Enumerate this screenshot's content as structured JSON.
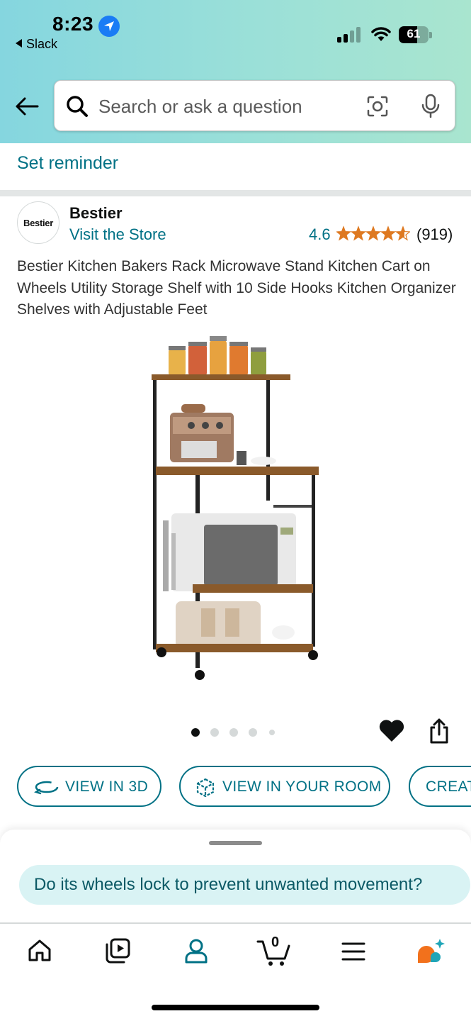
{
  "status_bar": {
    "time": "8:23",
    "back_app": "Slack",
    "battery_percent": "61",
    "battery_level": 0.61
  },
  "search": {
    "placeholder": "Search or ask a question"
  },
  "reminder": {
    "label": "Set reminder"
  },
  "brand": {
    "logo_text": "Bestier",
    "name": "Bestier",
    "store_link": "Visit the Store"
  },
  "rating": {
    "value": "4.6",
    "stars": 4.6,
    "count": "(919)"
  },
  "product": {
    "title": "Bestier Kitchen Bakers Rack Microwave Stand Kitchen Cart on Wheels Utility Storage Shelf with 10 Side Hooks Kitchen Organizer Shelves with Adjustable Feet",
    "image_count": 5,
    "active_image_index": 0
  },
  "actions": {
    "view_3d": "VIEW IN 3D",
    "view_room": "VIEW IN YOUR ROOM",
    "create": "CREAT"
  },
  "assistant": {
    "question": "Do its wheels lock to prevent unwanted movement?"
  },
  "bottom_nav": {
    "cart_count": "0",
    "items": [
      "home-icon",
      "video-icon",
      "account-icon",
      "cart-icon",
      "menu-icon",
      "rufus-icon"
    ]
  },
  "colors": {
    "accent": "#007185",
    "star": "#de7921",
    "header_start": "#85d6df",
    "header_end": "#a9e5cf",
    "chip_bg": "#d9f3f4"
  }
}
